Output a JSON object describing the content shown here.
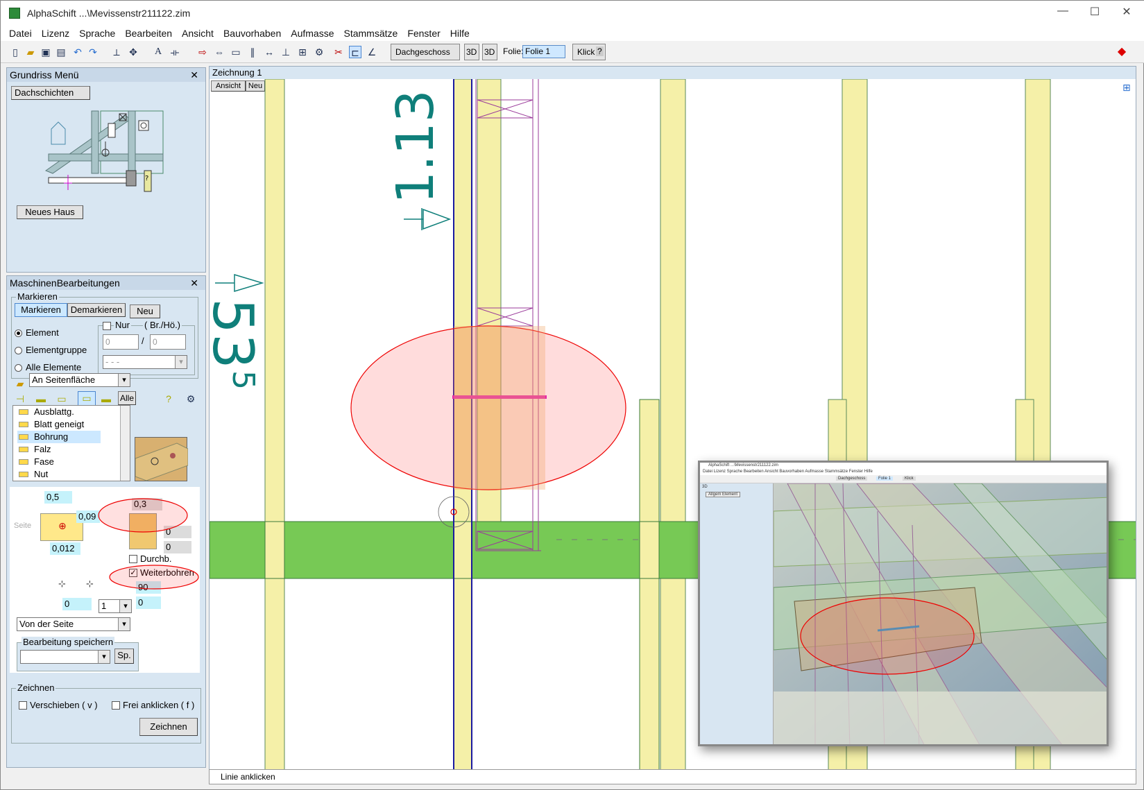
{
  "window": {
    "title": "AlphaSchift ...\\Mevissenstr211122.zim",
    "controls": [
      "—",
      "☐",
      "✕"
    ]
  },
  "menu": [
    "Datei",
    "Lizenz",
    "Sprache",
    "Bearbeiten",
    "Ansicht",
    "Bauvorhaben",
    "Aufmasse",
    "Stammsätze",
    "Fenster",
    "Hilfe"
  ],
  "toolbar": {
    "floor": "Dachgeschoss",
    "btn3d_a": "3D",
    "btn3d_b": "3D",
    "folie_label": "Folie:",
    "folie_value": "Folie 1",
    "klick": "Klick",
    "klick_help": "?"
  },
  "grundriss": {
    "title": "Grundriss Menü",
    "tab": "Dachschichten",
    "new_house": "Neues Haus",
    "help": "?"
  },
  "maschinen": {
    "title": "MaschinenBearbeitungen",
    "markieren_group": "Markieren",
    "markieren": "Markieren",
    "demarkieren": "Demarkieren",
    "neu": "Neu",
    "radio_element": "Element",
    "radio_gruppe": "Elementgruppe",
    "radio_alle": "Alle Elemente",
    "nur": "Nur",
    "brho": "( Br./Hö.)",
    "input_a": "0",
    "slash": "/",
    "input_b": "0",
    "dash_select": "- - -",
    "seitenflaeche": "An Seitenfläche",
    "alle": "Alle",
    "list": [
      "Ausblattg.",
      "Blatt geneigt",
      "Bohrung",
      "Falz",
      "Fase",
      "Nut"
    ],
    "selected_index": 2,
    "seite": "Seite",
    "v_05": "0,5",
    "v_009": "0,09",
    "v_0012": "0,012",
    "v_03": "0,3",
    "v_0a": "0",
    "v_0b": "0",
    "durchb": "Durchb.",
    "weiterbohren": "Weiterbohren",
    "v_90": "90",
    "v_0c": "0",
    "v_0d": "0",
    "count": "1",
    "von_der_seite": "Von der Seite",
    "bearb_speichern": "Bearbeitung speichern",
    "sp": "Sp.",
    "zeichnen_group": "Zeichnen",
    "verschieben": "Verschieben ( v )",
    "frei": "Frei anklicken ( f )",
    "zeichnen": "Zeichnen"
  },
  "drawing": {
    "title": "Zeichnung 1",
    "ansicht": "Ansicht",
    "neu": "Neu",
    "dim_a": "1.13",
    "dim_b": "53",
    "dim_b_sup": "5"
  },
  "status": "Linie anklicken",
  "inset": {
    "title": "AlphaSchift ...\\Mevissenstr211122.zim",
    "menu": "Datei  Lizenz  Sprache  Bearbeiten  Ansicht  Bauvorhaben  Aufmasse  Stammsätze  Fenster  Hilfe",
    "panel": "3D",
    "panel_btn": "Allgem Element",
    "floor": "Dachgeschoss",
    "folie": "Folie 1",
    "klick": "Klick"
  },
  "colors": {
    "highlight": "#ff0000",
    "timber": "#f5f0a8",
    "green_beam": "#77c955",
    "dim_teal": "#0f7f7a",
    "blue_line": "#1a1aa0",
    "purple_line": "#9a3a9a"
  }
}
